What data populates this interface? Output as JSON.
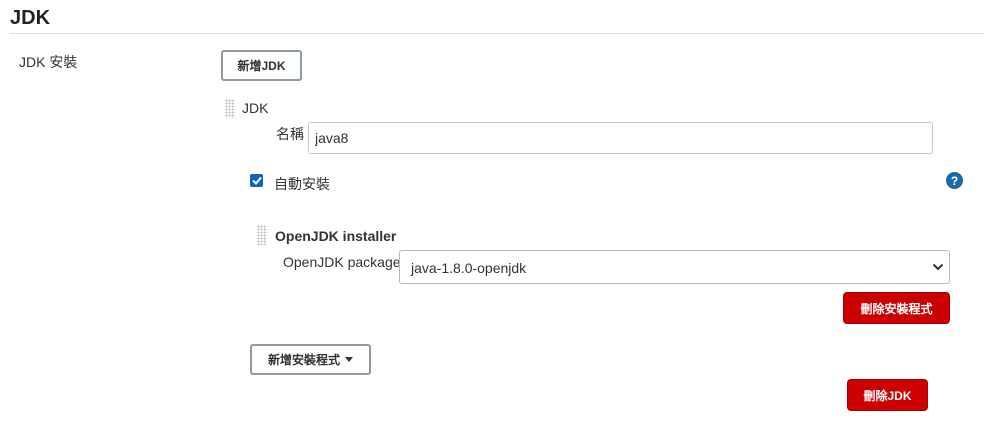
{
  "section": {
    "title": "JDK"
  },
  "jdk_installations": {
    "label": "JDK 安裝",
    "add_button": "新增JDK"
  },
  "jdk_entry": {
    "header": "JDK",
    "name_label": "名稱",
    "name_value": "java8",
    "auto_install_label": "自動安裝",
    "auto_install_checked": true,
    "help_icon": "?"
  },
  "installer": {
    "title": "OpenJDK installer",
    "package_label": "OpenJDK package",
    "package_value": "java-1.8.0-openjdk",
    "delete_installer_button": "刪除安裝程式"
  },
  "add_installer_button": "新增安裝程式",
  "delete_jdk_button": "刪除JDK",
  "colors": {
    "danger": "#cc0000",
    "accent": "#0b63c9",
    "help": "#1b6ba8"
  },
  "icons": {
    "checkbox": "check-icon",
    "help": "question-circle-icon",
    "select": "chevron-down-icon",
    "dropdown": "caret-down-icon",
    "drag": "drag-handle-icon"
  }
}
